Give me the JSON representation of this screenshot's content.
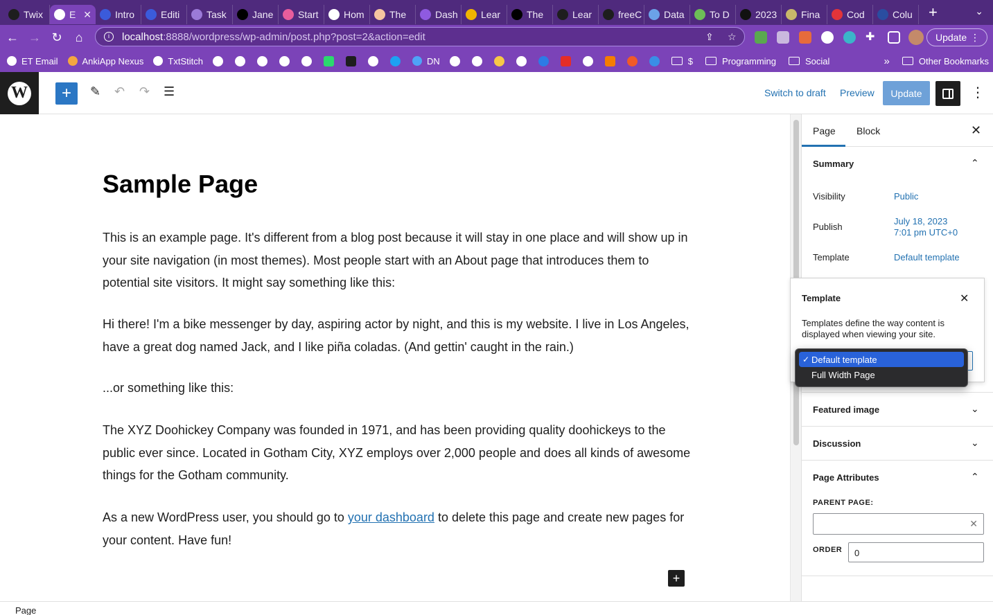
{
  "browser": {
    "tabs": [
      {
        "title": "Twix",
        "icon": "github-icon",
        "color": "#1e1e1e"
      },
      {
        "title": "E",
        "icon": "wordpress-icon",
        "color": "#ffffff",
        "active": true
      },
      {
        "title": "Intro",
        "icon": "app-icon",
        "color": "#3b5bdb"
      },
      {
        "title": "Editi",
        "icon": "app-icon",
        "color": "#3b5bdb"
      },
      {
        "title": "Task",
        "icon": "task-icon",
        "color": "#9b7ad8"
      },
      {
        "title": "Jane",
        "icon": "x-icon",
        "color": "#000000"
      },
      {
        "title": "Start",
        "icon": "rocket-icon",
        "color": "#e85d9c"
      },
      {
        "title": "Hom",
        "icon": "globe-icon",
        "color": "#ffffff"
      },
      {
        "title": "The",
        "icon": "avatar-icon",
        "color": "#f5c6a0"
      },
      {
        "title": "Dash",
        "icon": "dash-icon",
        "color": "#8f5ae0"
      },
      {
        "title": "Lear",
        "icon": "js-icon",
        "color": "#f0b400"
      },
      {
        "title": "The",
        "icon": "jjs-icon",
        "color": "#000000"
      },
      {
        "title": "Lear",
        "icon": "lambda-icon",
        "color": "#1e1e1e"
      },
      {
        "title": "freeC",
        "icon": "lambda-icon",
        "color": "#1e1e1e"
      },
      {
        "title": "Data",
        "icon": "data-icon",
        "color": "#6ba2e8"
      },
      {
        "title": "To D",
        "icon": "plant-icon",
        "color": "#6dbd57"
      },
      {
        "title": "2023",
        "icon": "f-icon",
        "color": "#111111"
      },
      {
        "title": "Fina",
        "icon": "pen-icon",
        "color": "#c9b86a"
      },
      {
        "title": "Cod",
        "icon": "cod-icon",
        "color": "#e3343a"
      },
      {
        "title": "Colu",
        "icon": "col-icon",
        "color": "#2a4da0"
      }
    ],
    "url_host": "localhost",
    "url_path": ":8888/wordpress/wp-admin/post.php?post=2&action=edit",
    "update_label": "Update",
    "bookmarks": {
      "named": [
        {
          "label": "ET Email",
          "color": "#ffffff"
        },
        {
          "label": "AnkiApp Nexus",
          "color": "#f4a640"
        },
        {
          "label": "TxtStitch",
          "color": "#ffffff"
        }
      ],
      "dn_label": "DN",
      "dollar_label": "$",
      "programming_label": "Programming",
      "social_label": "Social",
      "overflow": "»",
      "other_label": "Other Bookmarks"
    }
  },
  "editor": {
    "switch_to_draft": "Switch to draft",
    "preview": "Preview",
    "update": "Update",
    "title": "Sample Page",
    "paragraphs": {
      "p1": "This is an example page. It's different from a blog post because it will stay in one place and will show up in your site navigation (in most themes). Most people start with an About page that introduces them to potential site visitors. It might say something like this:",
      "p2": "Hi there! I'm a bike messenger by day, aspiring actor by night, and this is my website. I live in Los Angeles, have a great dog named Jack, and I like piña coladas. (And gettin' caught in the rain.)",
      "p3": "...or something like this:",
      "p4": "The XYZ Doohickey Company was founded in 1971, and has been providing quality doohickeys to the public ever since. Located in Gotham City, XYZ employs over 2,000 people and does all kinds of awesome things for the Gotham community.",
      "p5_before": "As a new WordPress user, you should go to ",
      "p5_link": "your dashboard",
      "p5_after": " to delete this page and create new pages for your content. Have fun!"
    },
    "status": "Page"
  },
  "sidebar": {
    "tab_page": "Page",
    "tab_block": "Block",
    "summary_title": "Summary",
    "visibility_label": "Visibility",
    "visibility_value": "Public",
    "publish_label": "Publish",
    "publish_date": "July 18, 2023",
    "publish_time": "7:01 pm UTC+0",
    "template_label": "Template",
    "template_value": "Default template",
    "featured_image": "Featured image",
    "discussion": "Discussion",
    "page_attributes": "Page Attributes",
    "parent_page_label": "PARENT PAGE:",
    "order_label": "ORDER",
    "order_value": "0"
  },
  "template_popover": {
    "title": "Template",
    "description": "Templates define the way content is displayed when viewing your site.",
    "options": [
      "Default template",
      "Full Width Page"
    ],
    "selected": "Default template"
  },
  "colors": {
    "browser_tabbar": "#4f2a7d",
    "browser_toolbar": "#7b43b8",
    "wp_blue": "#2271b1",
    "update_button": "#6ea1d8",
    "dropdown_highlight": "#2962d9"
  }
}
